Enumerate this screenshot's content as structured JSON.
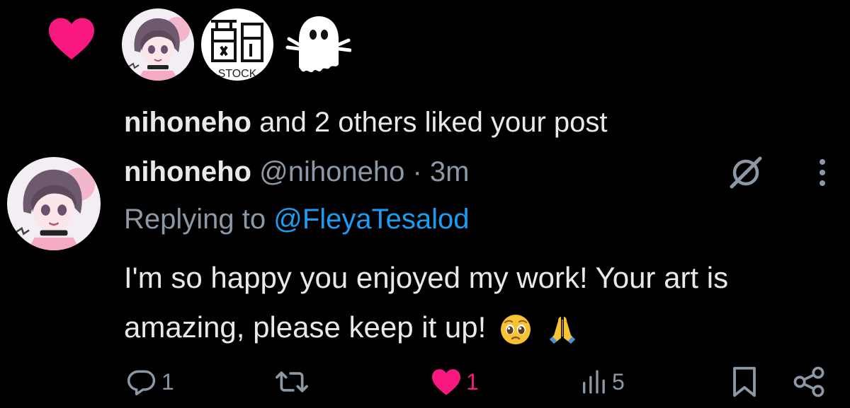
{
  "notification": {
    "liked_by_name": "nihoneho",
    "liked_rest": " and 2 others liked your post",
    "avatars": [
      {
        "name": "nihoneho avatar"
      },
      {
        "name": "stock avatar",
        "caption": "STOCK"
      },
      {
        "name": "ghost avatar"
      }
    ]
  },
  "post": {
    "display_name": "nihoneho",
    "handle": "@nihoneho",
    "separator": "·",
    "time": "3m",
    "replying_prefix": "Replying to ",
    "replying_to": "@FleyaTesalod",
    "body_line1": "I'm so happy you enjoyed my work! Your art is",
    "body_line2": "amazing, please keep it up!"
  },
  "actions": {
    "replies": "1",
    "retweets": "",
    "likes": "1",
    "views": "5"
  },
  "colors": {
    "background": "#000000",
    "text_primary": "#e7e9ea",
    "text_secondary": "#8b98a5",
    "link": "#1d9bf0",
    "like": "#f91880"
  },
  "icons": {
    "like_notification": "heart-icon",
    "grok": "grok-icon",
    "more": "more-vertical-icon",
    "reply": "reply-icon",
    "retweet": "retweet-icon",
    "like": "heart-icon",
    "views": "views-icon",
    "bookmark": "bookmark-icon",
    "share": "share-icon"
  }
}
